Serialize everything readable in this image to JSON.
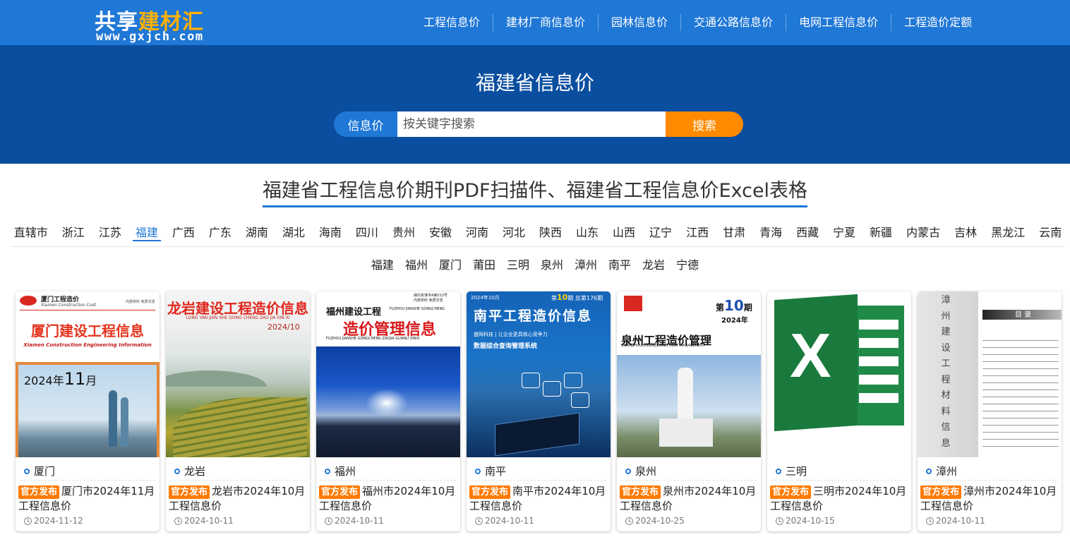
{
  "logo": {
    "main_white": "共享",
    "main_orange": "建材汇",
    "url": "www.gxjch.com"
  },
  "nav": [
    "工程信息价",
    "建材厂商信息价",
    "园林信息价",
    "交通公路信息价",
    "电网工程信息价",
    "工程造价定额"
  ],
  "hero": {
    "title": "福建省信息价",
    "search_label": "信息价",
    "search_placeholder": "按关键字搜索",
    "search_button": "搜索"
  },
  "section_title": "福建省工程信息价期刊PDF扫描件、福建省工程信息价Excel表格",
  "provinces": [
    "直辖市",
    "浙江",
    "江苏",
    "福建",
    "广西",
    "广东",
    "湖南",
    "湖北",
    "海南",
    "四川",
    "贵州",
    "安徽",
    "河南",
    "河北",
    "陕西",
    "山东",
    "山西",
    "辽宁",
    "江西",
    "甘肃",
    "青海",
    "西藏",
    "宁夏",
    "新疆",
    "内蒙古",
    "吉林",
    "黑龙江",
    "云南"
  ],
  "active_province": "福建",
  "cities": [
    "福建",
    "福州",
    "厦门",
    "莆田",
    "三明",
    "泉州",
    "漳州",
    "南平",
    "龙岩",
    "宁德"
  ],
  "badge_label": "官方发布",
  "cards": [
    {
      "city": "厦门",
      "title": "厦门市2024年11月工程信息价",
      "date": "2024-11-12",
      "cover": {
        "org": "厦门工程造价",
        "org_en": "Xiamen Construction Cost",
        "side": "内部资料 免费交流",
        "title": "厦门建设工程信息",
        "subtitle": "Xiamen Construction Engineering Information",
        "year": "2024年",
        "month": "11",
        "month_suffix": "月"
      }
    },
    {
      "city": "龙岩",
      "title": "龙岩市2024年10月工程信息价",
      "date": "2024-10-11",
      "cover": {
        "title": "龙岩建设工程造价信息",
        "pinyin": "LONG YAN JIAN SHE GONG CHENG ZAO JIA XIN XI",
        "issue": "2024/10"
      }
    },
    {
      "city": "福州",
      "title": "福州市2024年10月工程信息价",
      "date": "2024-10-11",
      "cover": {
        "line1": "福州建设工程",
        "line1_en": "FUZHOU JIANSHE GONGCHENG",
        "title": "造价管理信息",
        "pinyin": "FUZHOU JIANSHE GONGCHENG ZAOJIA GUANLI XINXI",
        "top_note": "闽内资准字A第013号",
        "top_note2": "内部资料 免费交流"
      }
    },
    {
      "city": "南平",
      "title": "南平市2024年10月工程信息价",
      "date": "2024-10-11",
      "cover": {
        "issue_prefix": "第",
        "issue_no": "10",
        "issue_suffix": "期 总第176期",
        "top_date": "2024年10月",
        "title": "南平工程造价信息",
        "brand_line": "盛网科技 | 让企业更具核心竞争力",
        "system_line": "数据综合查询管理系统"
      }
    },
    {
      "city": "泉州",
      "title": "泉州市2024年10月工程信息价",
      "date": "2024-10-25",
      "cover": {
        "issue_prefix": "第",
        "issue_no": "10",
        "issue_suffix": "期",
        "year": "2024年",
        "title": "泉州工程造价管理",
        "en": "QUANZHOU ENGINEERING COST MANAGEMENT"
      }
    },
    {
      "city": "三明",
      "title": "三明市2024年10月工程信息价",
      "date": "2024-10-15",
      "cover": {
        "letter": "X"
      }
    },
    {
      "city": "漳州",
      "title": "漳州市2024年10月工程信息价",
      "date": "2024-10-11",
      "cover": {
        "vertical": [
          "漳",
          "州",
          "建",
          "设",
          "工",
          "程",
          "材",
          "料",
          "信",
          "息"
        ],
        "toc": "目 录"
      }
    }
  ]
}
